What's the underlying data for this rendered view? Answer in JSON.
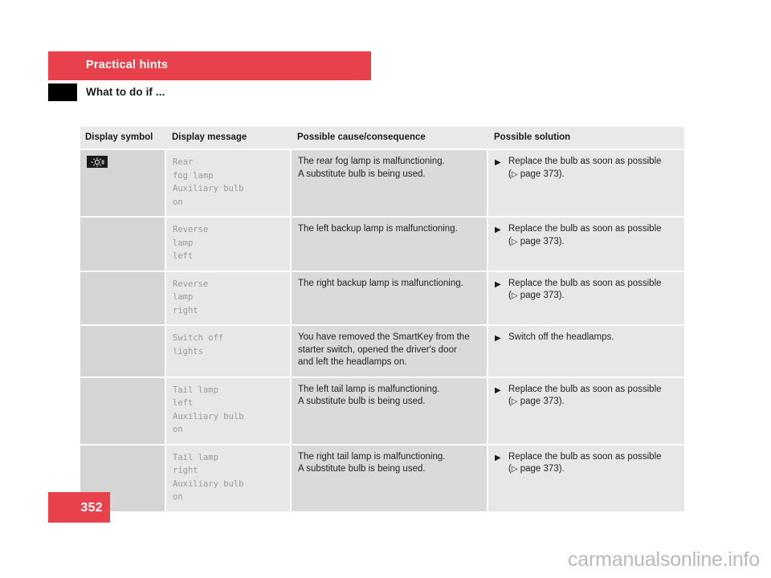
{
  "header": {
    "chapter": "Practical hints",
    "section": "What to do if ..."
  },
  "table": {
    "columns": [
      "Display symbol",
      "Display message",
      "Possible cause/consequence",
      "Possible solution"
    ],
    "rows": [
      {
        "symbol_icon": "rear-fog-lamp-icon",
        "message": [
          "Rear",
          "fog lamp",
          "Auxiliary bulb",
          "on"
        ],
        "cause": [
          "The rear fog lamp is malfunctioning.",
          "A substitute bulb is being used."
        ],
        "solution": {
          "text": "Replace the bulb as soon as possible",
          "ref_open": "(",
          "ref_label": "page 373",
          "ref_close": ")."
        }
      },
      {
        "symbol_icon": "",
        "message": [
          "Reverse",
          "lamp",
          "left"
        ],
        "cause": [
          "The left backup lamp is malfunctioning."
        ],
        "solution": {
          "text": "Replace the bulb as soon as possible",
          "ref_open": "(",
          "ref_label": "page 373",
          "ref_close": ")."
        }
      },
      {
        "symbol_icon": "",
        "message": [
          "Reverse",
          "lamp",
          "right"
        ],
        "cause": [
          "The right backup lamp is malfunctioning."
        ],
        "solution": {
          "text": "Replace the bulb as soon as possible",
          "ref_open": "(",
          "ref_label": "page 373",
          "ref_close": ")."
        }
      },
      {
        "symbol_icon": "",
        "message": [
          "Switch off",
          "lights"
        ],
        "cause": [
          "You have removed the SmartKey from the",
          "starter switch, opened the driver's door",
          "and left the headlamps on."
        ],
        "solution": {
          "text": "Switch off the headlamps.",
          "ref_open": "",
          "ref_label": "",
          "ref_close": ""
        }
      },
      {
        "symbol_icon": "",
        "message": [
          "Tail lamp",
          "left",
          "Auxiliary bulb",
          "on"
        ],
        "cause": [
          "The left tail lamp is malfunctioning.",
          "A substitute bulb is being used."
        ],
        "solution": {
          "text": "Replace the bulb as soon as possible",
          "ref_open": "(",
          "ref_label": "page 373",
          "ref_close": ")."
        }
      },
      {
        "symbol_icon": "",
        "message": [
          "Tail lamp",
          "right",
          "Auxiliary bulb",
          "on"
        ],
        "cause": [
          "The right tail lamp is malfunctioning.",
          "A substitute bulb is being used."
        ],
        "solution": {
          "text": "Replace the bulb as soon as possible",
          "ref_open": "(",
          "ref_label": "page 373",
          "ref_close": ")."
        }
      }
    ]
  },
  "footer": {
    "page_number": "352",
    "watermark": "carmanualsonline.info"
  },
  "colors": {
    "accent_red": "#e8414b",
    "marker_black": "#000000",
    "col_symbol_bg": "#d5d5d5",
    "col_message_bg": "#e7e7e7",
    "col_cause_bg": "#dadada",
    "col_solution_bg": "#e7e7e7",
    "header_bg": "#e9e9e9",
    "mono_text": "#9a9a9a",
    "watermark_text": "#b9b9b9"
  },
  "glyphs": {
    "bullet": "▶",
    "page_triangle": "▷"
  }
}
